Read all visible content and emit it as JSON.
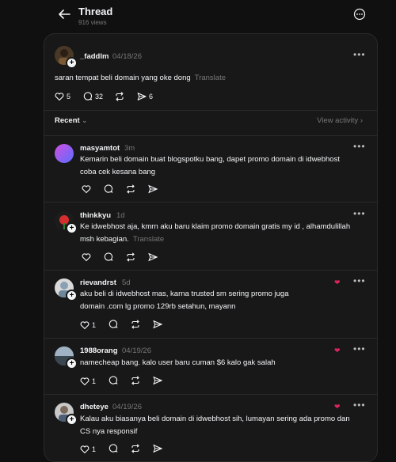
{
  "header": {
    "title": "Thread",
    "views": "916 views"
  },
  "post": {
    "username": "_faddlm",
    "date": "04/18/26",
    "text": "saran tempat beli domain yang oke dong",
    "translate": "Translate",
    "likes": "5",
    "comments": "32",
    "shares": "6"
  },
  "sort": {
    "label": "Recent",
    "view_activity": "View activity"
  },
  "replies": [
    {
      "username": "masyamtot",
      "time": "3m",
      "text_line1": "Kemarin beli domain buat blogspotku bang, dapet promo domain di idwebhost",
      "text_line2": "coba cek kesana bang",
      "likes": ""
    },
    {
      "username": "thinkkyu",
      "time": "1d",
      "text_line1": "Ke idwebhost aja, kmrn aku baru klaim promo domain gratis my id , alhamdulillah",
      "text_line2": "msh kebagian.",
      "translate": "Translate",
      "likes": ""
    },
    {
      "username": "rievandrst",
      "time": "5d",
      "text_line1": "aku beli di idwebhost mas, karna trusted sm sering promo juga",
      "text_line2": "domain .com lg promo 129rb setahun, mayann",
      "likes": "1"
    },
    {
      "username": "1988orang",
      "time": "04/19/26",
      "text_line1": "namecheap bang. kalo user baru cuman $6 kalo gak salah",
      "text_line2": "",
      "likes": "1"
    },
    {
      "username": "dheteye",
      "time": "04/19/26",
      "text_line1": "Kalau aku biasanya beli domain di idwebhost sih, lumayan sering ada promo dan",
      "text_line2": "CS nya responsif",
      "likes": "1"
    }
  ]
}
